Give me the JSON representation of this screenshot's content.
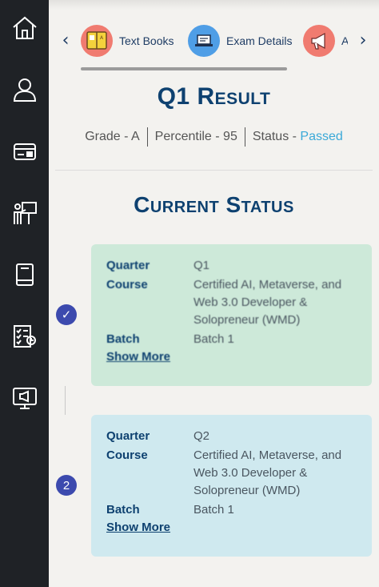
{
  "tabs": {
    "items": [
      {
        "label": "Text Books",
        "icon": "textbook-icon"
      },
      {
        "label": "Exam Details",
        "icon": "laptop-exam-icon"
      },
      {
        "label": "A",
        "icon": "megaphone-icon"
      }
    ],
    "prev_arrow": "‹",
    "next_arrow": "›"
  },
  "result": {
    "title": "Q1 Result",
    "grade": "Grade - A",
    "percentile": "Percentile - 95",
    "status_prefix": "Status - ",
    "status_value": "Passed"
  },
  "current_status": {
    "title": "Current Status",
    "cards": [
      {
        "marker": "✓",
        "quarter_label": "Quarter",
        "quarter_value": "Q1",
        "course_label": "Course",
        "course_value": "Certified AI, Metaverse, and Web 3.0 Developer & Solopreneur (WMD)",
        "batch_label": "Batch",
        "batch_value": "Batch 1",
        "show_more": "Show More"
      },
      {
        "marker": "2",
        "quarter_label": "Quarter",
        "quarter_value": "Q2",
        "course_label": "Course",
        "course_value": "Certified AI, Metaverse, and Web 3.0 Developer & Solopreneur (WMD)",
        "batch_label": "Batch",
        "batch_value": "Batch 1",
        "show_more": "Show More"
      }
    ]
  },
  "sidebar": {
    "items": [
      "home-icon",
      "user-icon",
      "card-icon",
      "presentation-icon",
      "book-icon",
      "checklist-icon",
      "monitor-announcement-icon"
    ]
  },
  "colors": {
    "accent": "#0e4170",
    "passed": "#3aa9d8",
    "card_done": "#cde9d9",
    "card_current": "#cfe9ef",
    "sidebar": "#1f2226"
  }
}
